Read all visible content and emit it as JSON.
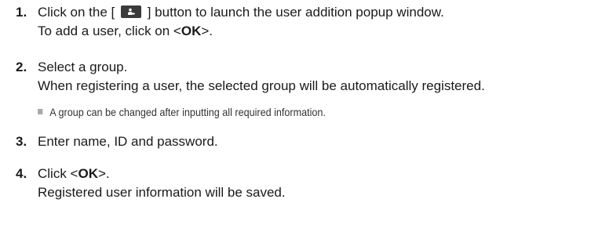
{
  "steps": [
    {
      "number": "1.",
      "line1_before": "Click on the [",
      "button_icon": "add-user-icon",
      "line1_after": "] button to launch the user addition popup window.",
      "line2_before": "To add a user, click on <",
      "line2_bold": "OK",
      "line2_after": ">."
    },
    {
      "number": "2.",
      "line1": "Select a group.",
      "line2": "When registering a user, the selected group will be automatically registered.",
      "note": "A group can be changed after inputting all required information."
    },
    {
      "number": "3.",
      "line1": "Enter name, ID and password."
    },
    {
      "number": "4.",
      "line1_before": "Click <",
      "line1_bold": "OK",
      "line1_after": ">.",
      "line2": "Registered user information will be saved."
    }
  ]
}
